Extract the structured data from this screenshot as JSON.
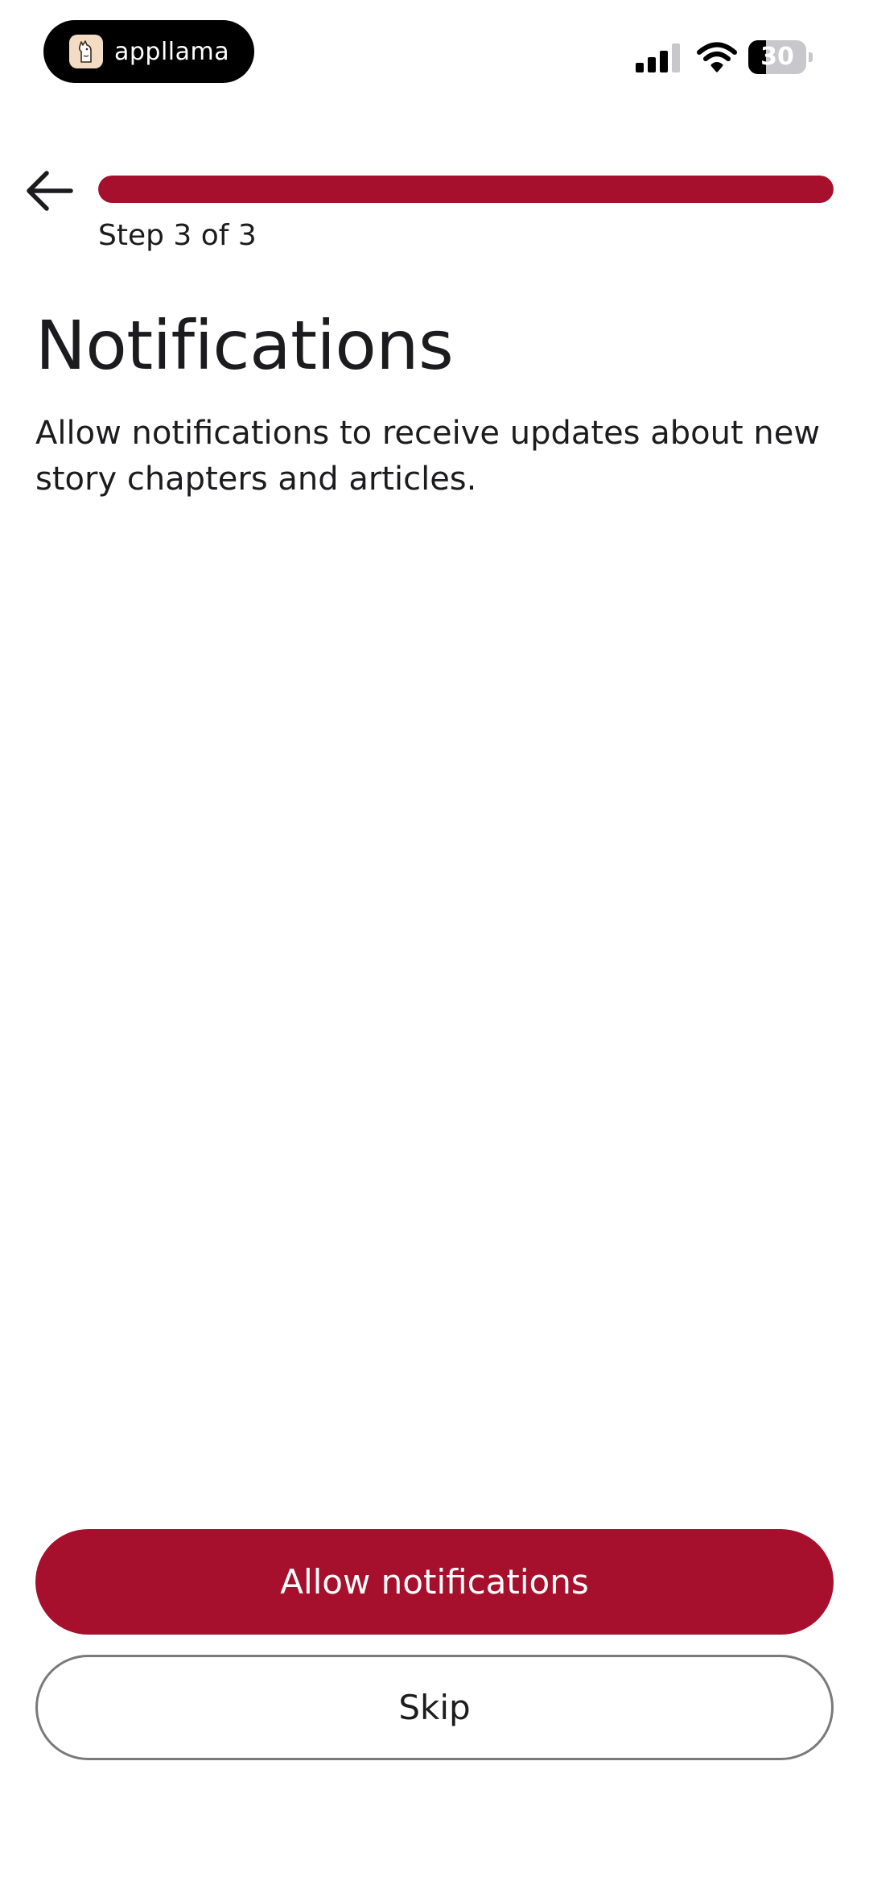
{
  "status_bar": {
    "app_name": "appllama",
    "battery_level": "30",
    "battery_percent": 30,
    "signal_bars_active": 3,
    "signal_bars_total": 4,
    "icons": [
      "llama-logo-icon",
      "signal-icon",
      "wifi-icon",
      "battery-icon"
    ]
  },
  "header": {
    "back_icon": "arrow-left-icon",
    "step_label": "Step 3 of 3",
    "progress_fraction": 1.0
  },
  "content": {
    "title": "Notifications",
    "description": "Allow notifications to receive updates about new story chapters and articles."
  },
  "actions": {
    "allow_label": "Allow notifications",
    "skip_label": "Skip"
  },
  "colors": {
    "accent": "#a6102c",
    "text": "#1c1c1e",
    "skip_border": "#7a7a7a",
    "background": "#ffffff"
  }
}
